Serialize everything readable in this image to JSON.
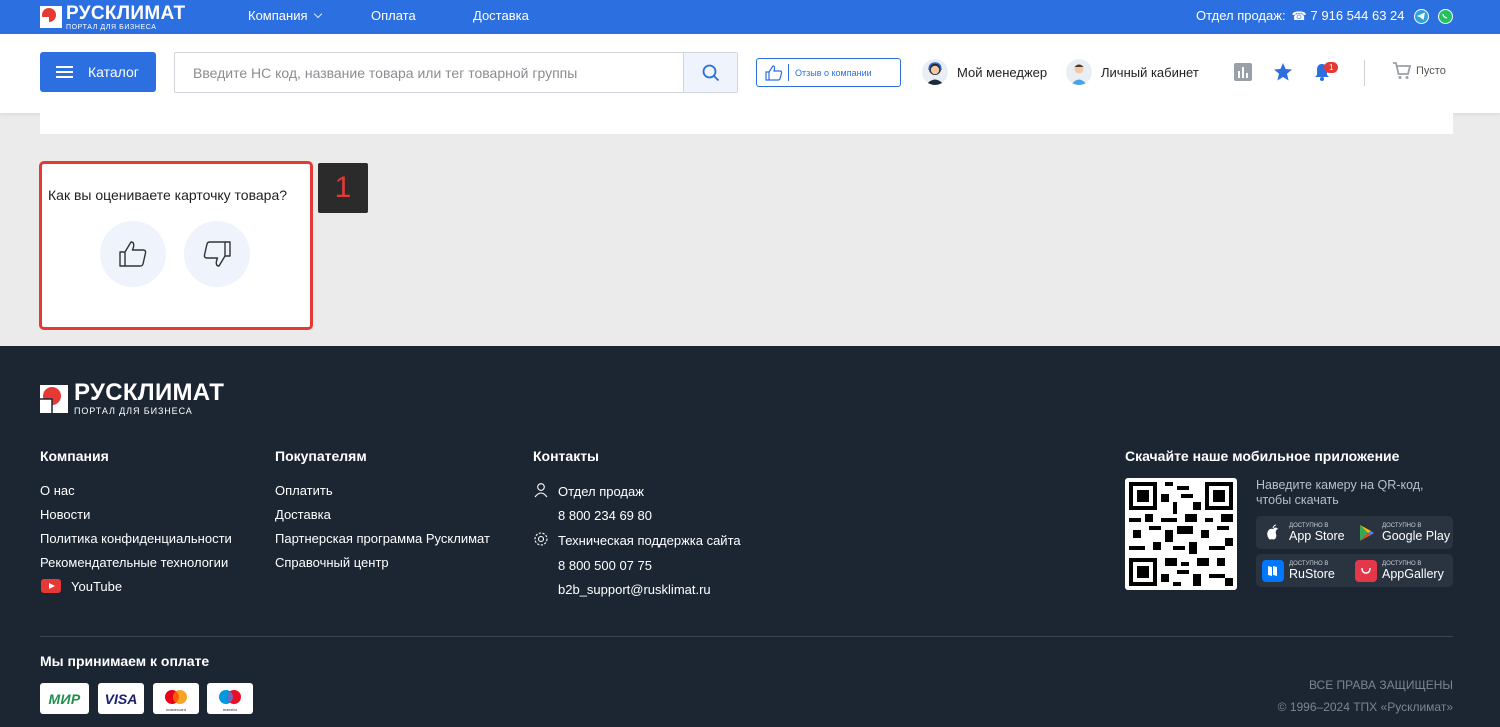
{
  "brand": {
    "name": "РУСКЛИМАТ",
    "tagline": "ПОРТАЛ ДЛЯ БИЗНЕСА"
  },
  "topbar": {
    "nav": [
      {
        "label": "Компания",
        "has_dropdown": true
      },
      {
        "label": "Оплата"
      },
      {
        "label": "Доставка"
      }
    ],
    "sales_label": "Отдел продаж:",
    "sales_phone": "7 916 544 63 24"
  },
  "header": {
    "catalog_label": "Каталог",
    "search_placeholder": "Введите НС код, название товара или тег товарной группы",
    "review_label": "Отзыв о компании",
    "manager_label": "Мой менеджер",
    "cabinet_label": "Личный кабинет",
    "notifications_count": "1",
    "cart_label": "Пусто"
  },
  "rating": {
    "question": "Как вы оцениваете карточку товара?",
    "marker": "1"
  },
  "footer": {
    "columns": {
      "company": {
        "title": "Компания",
        "links": [
          "О нас",
          "Новости",
          "Политика конфиденциальности",
          "Рекомендательные технологии",
          "YouTube"
        ]
      },
      "buyers": {
        "title": "Покупателям",
        "links": [
          "Оплатить",
          "Доставка",
          "Партнерская программа Русклимат",
          "Справочный центр"
        ]
      },
      "contacts": {
        "title": "Контакты",
        "sales_label": "Отдел продаж",
        "sales_phone": "8 800 234 69 80",
        "support_label": "Техническая поддержка сайта",
        "support_phone": "8 800 500 07 75",
        "support_email": "b2b_support@rusklimat.ru"
      }
    },
    "app": {
      "title": "Скачайте наше мобильное приложение",
      "qr_text": "Наведите камеру на QR-код, чтобы скачать",
      "stores": [
        {
          "small": "ДОСТУПНО В",
          "name": "App Store"
        },
        {
          "small": "ДОСТУПНО В",
          "name": "Google Play"
        },
        {
          "small": "ДОСТУПНО В",
          "name": "RuStore"
        },
        {
          "small": "ДОСТУПНО В",
          "name": "AppGallery"
        }
      ]
    },
    "payment_title": "Мы принимаем к оплате",
    "payments": [
      "МИР",
      "VISA",
      "mastercard",
      "maestro"
    ],
    "rights": "ВСЕ ПРАВА ЗАЩИЩЕНЫ",
    "copyright": "© 1996–2024 ТПХ «Русклимат»"
  },
  "colors": {
    "primary": "#2c6fe0",
    "footer_bg": "#1c2633",
    "highlight": "#e53935",
    "page_bg": "#ebebeb"
  }
}
